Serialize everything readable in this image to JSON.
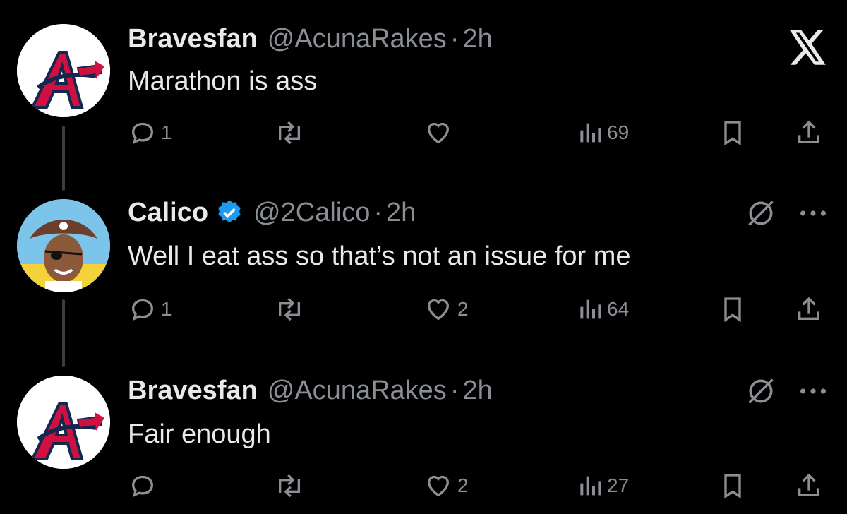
{
  "close_icon": "x-logo-icon",
  "tweets": [
    {
      "name": "Bravesfan",
      "handle": "@AcunaRakes",
      "separator": "·",
      "time": "2h",
      "text": "Marathon is ass",
      "verified": false,
      "replies": "1",
      "retweets": "",
      "likes": "",
      "views": "69"
    },
    {
      "name": "Calico",
      "handle": "@2Calico",
      "separator": "·",
      "time": "2h",
      "text": "Well I eat ass so that’s not an issue for me",
      "verified": true,
      "replies": "1",
      "retweets": "",
      "likes": "2",
      "views": "64"
    },
    {
      "name": "Bravesfan",
      "handle": "@AcunaRakes",
      "separator": "·",
      "time": "2h",
      "text": "Fair enough",
      "verified": false,
      "replies": "",
      "retweets": "",
      "likes": "2",
      "views": "27"
    }
  ],
  "colors": {
    "background": "#000000",
    "text_primary": "#e7e9ea",
    "text_secondary": "#8b8f94",
    "verified": "#1d9bf0",
    "braves_red": "#ce1141",
    "braves_navy": "#13274f"
  }
}
